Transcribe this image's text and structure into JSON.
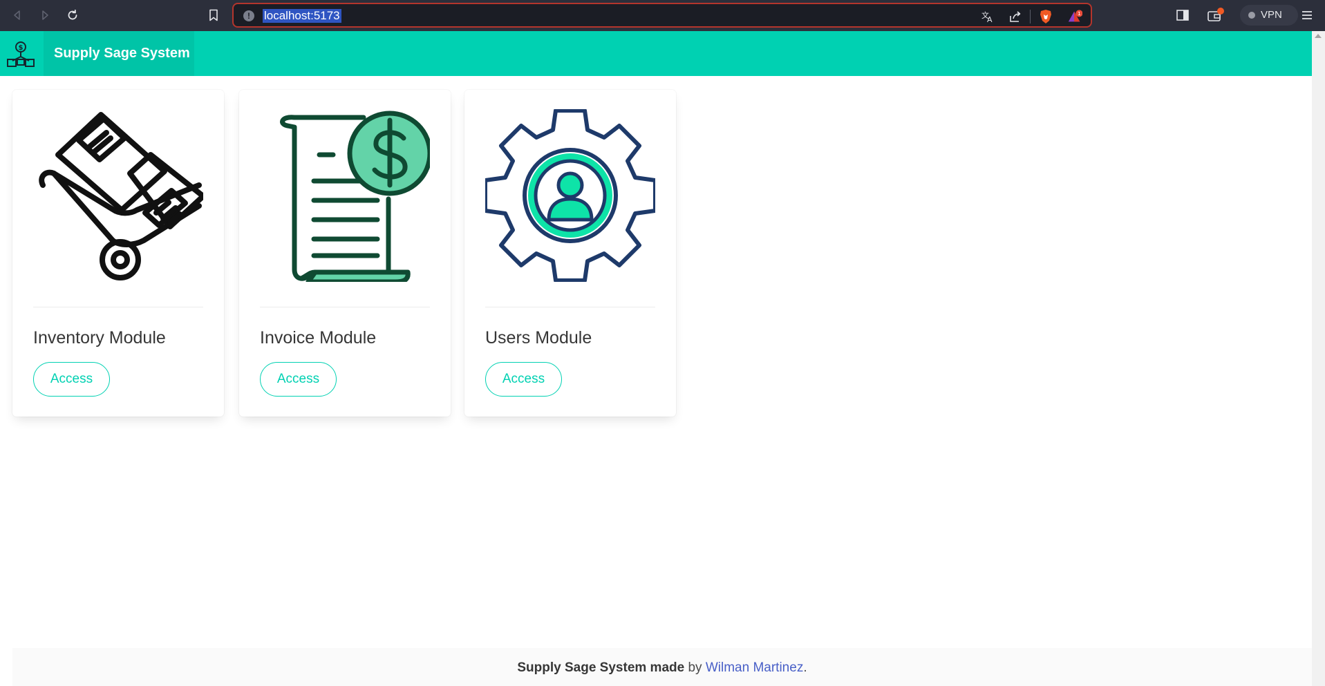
{
  "browser": {
    "url": "localhost:5173",
    "vpn_label": "VPN",
    "notification_count": "1"
  },
  "navbar": {
    "brand": "Supply Sage System"
  },
  "modules": [
    {
      "title": "Inventory Module",
      "button": "Access",
      "icon": "hand-truck-boxes-icon"
    },
    {
      "title": "Invoice Module",
      "button": "Access",
      "icon": "invoice-dollar-icon"
    },
    {
      "title": "Users Module",
      "button": "Access",
      "icon": "gear-user-icon"
    }
  ],
  "footer": {
    "brand": "Supply Sage System made",
    "by": "by",
    "author": "Wilman Martinez",
    "end": "."
  },
  "colors": {
    "primary": "#00d1b2",
    "invoice_green": "#0f4a32",
    "users_navy": "#1e3a6a",
    "link": "#485fc7"
  }
}
